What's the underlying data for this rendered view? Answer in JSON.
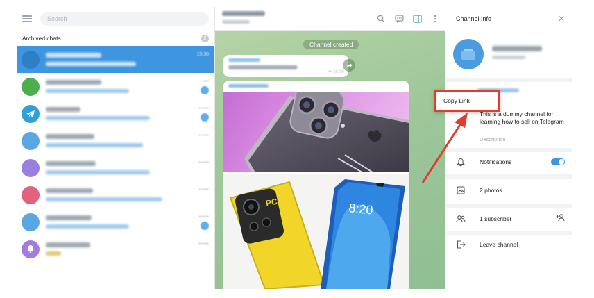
{
  "left": {
    "search_placeholder": "Search",
    "archived_label": "Archived chats",
    "archived_count": "2",
    "chats": [
      {
        "time": "15:30",
        "color": "#3e95e0",
        "active": true
      },
      {
        "time": "",
        "color": "#4cae4c",
        "badge": true
      },
      {
        "time": "",
        "color": "#2f9fdb",
        "badge": true
      },
      {
        "time": "",
        "color": "#5aa6e3"
      },
      {
        "time": "",
        "color": "#9a7ee0"
      },
      {
        "time": "",
        "color": "#e2617f"
      },
      {
        "time": "",
        "color": "#5aa6e3",
        "badge": true
      },
      {
        "time": "",
        "color": "#a17be3"
      }
    ]
  },
  "middle": {
    "system_message": "Channel created",
    "first_message_time": "15:30"
  },
  "right": {
    "title": "Channel Info",
    "description": "This is a dummy channel for learning how to sell on Telegram",
    "description_label": "Description",
    "notifications_label": "Notifications",
    "photos_label": "2 photos",
    "subscribers_label": "1 subscriber",
    "leave_label": "Leave channel"
  },
  "popup": {
    "copy_link_label": "Copy Link"
  },
  "colors": {
    "accent": "#3e95e0",
    "annotation": "#e23c2d"
  }
}
